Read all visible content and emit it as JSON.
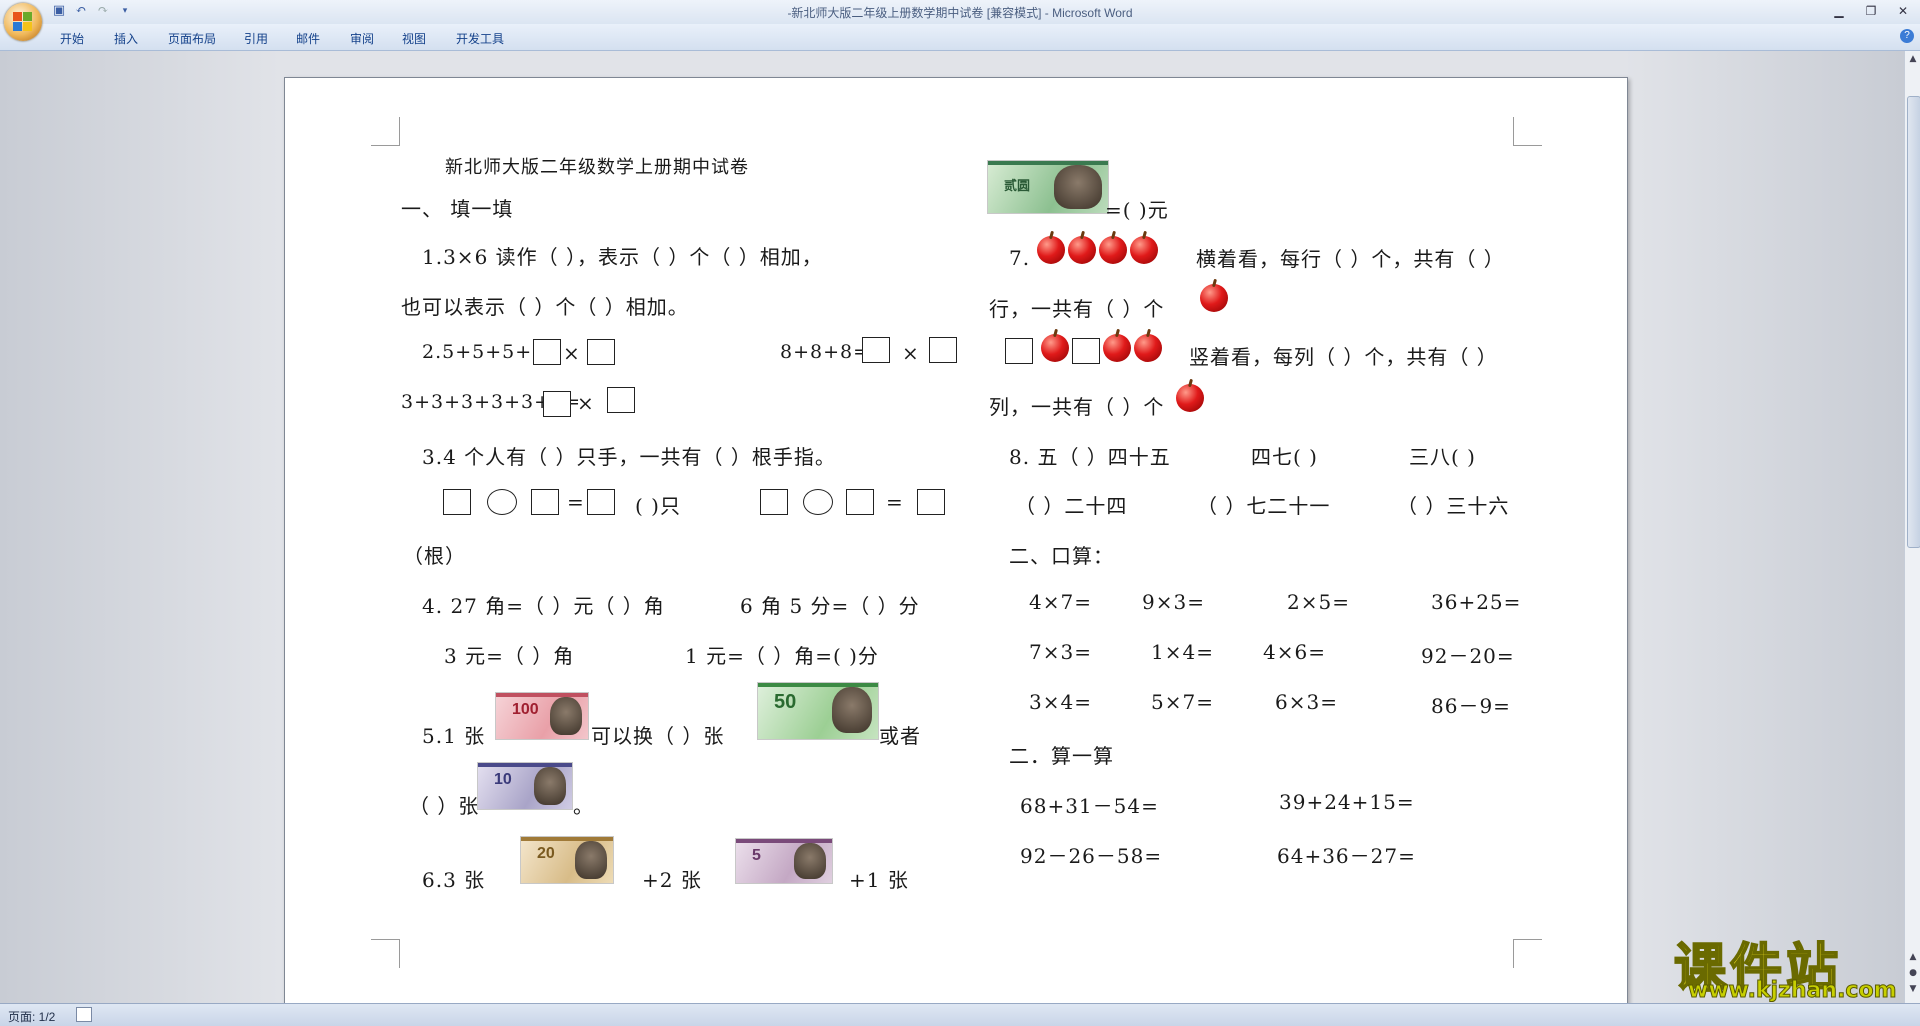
{
  "window": {
    "title": "-新北师大版二年级上册数学期中试卷 [兼容模式] - Microsoft Word"
  },
  "ribbon": {
    "tabs": [
      "开始",
      "插入",
      "页面布局",
      "引用",
      "邮件",
      "审阅",
      "视图",
      "开发工具"
    ]
  },
  "icons": {
    "office": "office-button-icon",
    "save": "save-icon",
    "undo": "undo-icon",
    "redo": "redo-icon",
    "customize": "qat-customize-icon",
    "help": "help-icon"
  },
  "status": {
    "page": "页面: 1/2"
  },
  "watermark": {
    "brand": "课件站",
    "url": "www.kjzhan.com"
  },
  "doc": {
    "title": "新北师大版二年级数学上册期中试卷",
    "sec1": "一、    填一填",
    "q1a": "1.3×6 读作（      ），表示（    ）个（     ）相加，",
    "q1b": "也可以表示（   ）个（   ）相加。",
    "q2a": "2.5+5+5+5=",
    "times": "×",
    "q2b": "8+8+8=",
    "q2c": "3+3+3+3+3+3=",
    "q3": "3.4 个人有（      ）只手，一共有（      ）根手指。",
    "eq": "=",
    "zhi": "(   )只",
    "gen": "（根）",
    "q4a": "4. 27 角=（   ）元（   ）角",
    "q4b": "6 角 5 分=（   ）分",
    "q4c": "3 元=（     ）角",
    "q4d": "1 元=（     ）角=(     )分",
    "q5a": "5.1  张",
    "q5b": "可以换（      ）张",
    "q5c": "或者",
    "q5d": "（ ）张",
    "q5e": "。",
    "q6a": "6.3    张",
    "q6b": "+2    张",
    "q6c": "+1    张",
    "bill100": "100",
    "bill50": "50",
    "bill10": "10",
    "bill20": "20",
    "bill5": "5",
    "bill2": "贰圆",
    "yuan": "=(      )元",
    "q7a": "7.",
    "q7b": "横着看，每行（    ）个，共有（    ）",
    "q7c": "行，一共有（    ）个",
    "q7d": "竖着看，每列（    ）个，共有（    ）",
    "q7e": "列，一共有（  ）个",
    "q8": "8.    五（  ）四十五",
    "q8b": "四七(          )",
    "q8c": "三八(        )",
    "q8d": "（    ）二十四",
    "q8e": "（    ）七二十一",
    "q8f": "（  ）三十六",
    "sec2": "二、口算：",
    "oral": [
      [
        "4×7=",
        "9×3=",
        "2×5=",
        "36+25="
      ],
      [
        "7×3=",
        "1×4=",
        "4×6=",
        "92－20="
      ],
      [
        "3×4=",
        "5×7=",
        "6×3=",
        "86－9="
      ]
    ],
    "sec3": "二．算一算",
    "calc": [
      [
        "68+31－54=",
        "39+24+15="
      ],
      [
        "92－26－58=",
        "64+36－27="
      ]
    ]
  }
}
